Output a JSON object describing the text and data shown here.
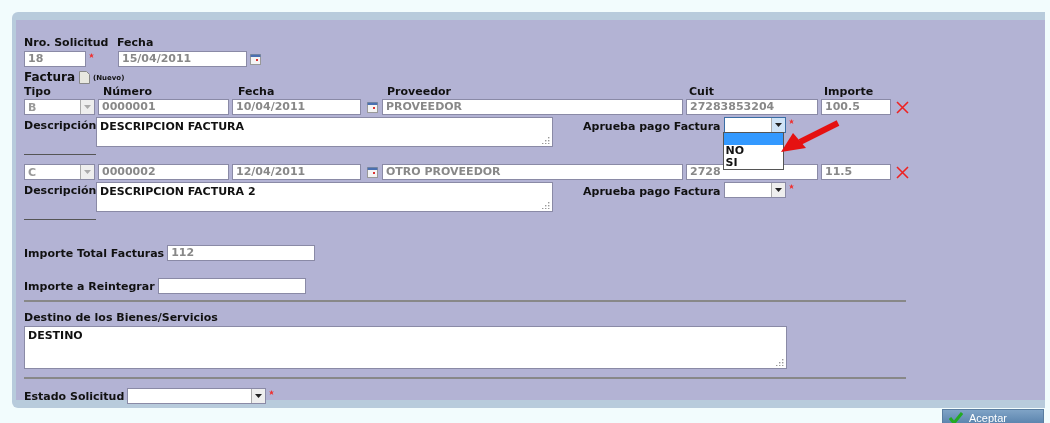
{
  "solicitud": {
    "nro_label": "Nro. Solicitud",
    "nro_value": "18",
    "fecha_label": "Fecha",
    "fecha_value": "15/04/2011"
  },
  "factura": {
    "title": "Factura",
    "badge": "(Nuevo)"
  },
  "columns": [
    "Tipo",
    "Número",
    "Fecha",
    "Proveedor",
    "Cuit",
    "Importe"
  ],
  "invoices": [
    {
      "tipo": "B",
      "numero": "0000001",
      "fecha": "10/04/2011",
      "proveedor": "PROVEEDOR",
      "cuit": "27283853204",
      "importe": "100.5",
      "desc_label": "Descripción",
      "descripcion": "DESCRIPCION FACTURA",
      "aprueba_label": "Aprueba pago Factura",
      "aprueba_open": true,
      "aprueba_options": [
        {
          "label": "NO",
          "selected": false
        },
        {
          "label": "SI",
          "selected": false
        }
      ]
    },
    {
      "tipo": "C",
      "numero": "0000002",
      "fecha": "12/04/2011",
      "proveedor": "OTRO PROVEEDOR",
      "cuit": "2728",
      "importe": "11.5",
      "desc_label": "Descripción",
      "descripcion": "DESCRIPCION FACTURA 2",
      "aprueba_label": "Aprueba pago Factura",
      "aprueba_open": false
    }
  ],
  "total": {
    "label": "Importe Total Facturas",
    "value": "112"
  },
  "reintegrar": {
    "label": "Importe a Reintegrar"
  },
  "destino": {
    "label": "Destino de los Bienes/Servicios",
    "value": "DESTINO"
  },
  "estado": {
    "label": "Estado Solicitud"
  },
  "accept_button": "Aceptar"
}
